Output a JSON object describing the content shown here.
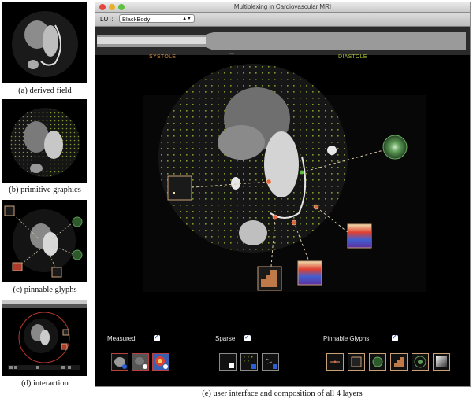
{
  "figure": {
    "captions": {
      "a": "(a) derived field",
      "b": "(b) primitive graphics",
      "c": "(c) pinnable glyphs",
      "d": "(d) interaction",
      "e": "(e) user interface and composition of all 4 layers"
    }
  },
  "window": {
    "title": "Multiplexing in Cardiovascular MRI",
    "traffic_lights": [
      "#e2463f",
      "#e7b02a",
      "#5fbf3e"
    ]
  },
  "toolbar": {
    "lut_label": "LUT:",
    "lut_value": "BlackBody"
  },
  "timeline": {
    "systole_label": "SYSTOLE",
    "diastole_label": "DIASTOLE",
    "systole_color": "#d08a3a",
    "diastole_color": "#a7c43a"
  },
  "controls": {
    "measured_label": "Measured",
    "sparse_label": "Sparse",
    "pinnable_label": "Pinnable Glyphs",
    "measured_checked": true,
    "sparse_checked": true,
    "pinnable_checked": true,
    "measured_buttons": [
      "magnitude-icon",
      "phase-icon",
      "heatmap-icon"
    ],
    "sparse_buttons": [
      "square-icon",
      "dots-icon",
      "arrows-icon"
    ],
    "glyph_buttons": [
      "line-glyph-icon",
      "box-glyph-icon",
      "ring-glyph-icon",
      "staircase-glyph-icon",
      "radar-glyph-icon",
      "gradient-glyph-icon"
    ]
  },
  "colors": {
    "glyph_line": "#d5c9a8",
    "glyph_dot": "#e0663e",
    "glyph_ring": "#3e7a3a",
    "grid_dot": "#7f9a2c",
    "glyph_border": "#c8a078"
  }
}
